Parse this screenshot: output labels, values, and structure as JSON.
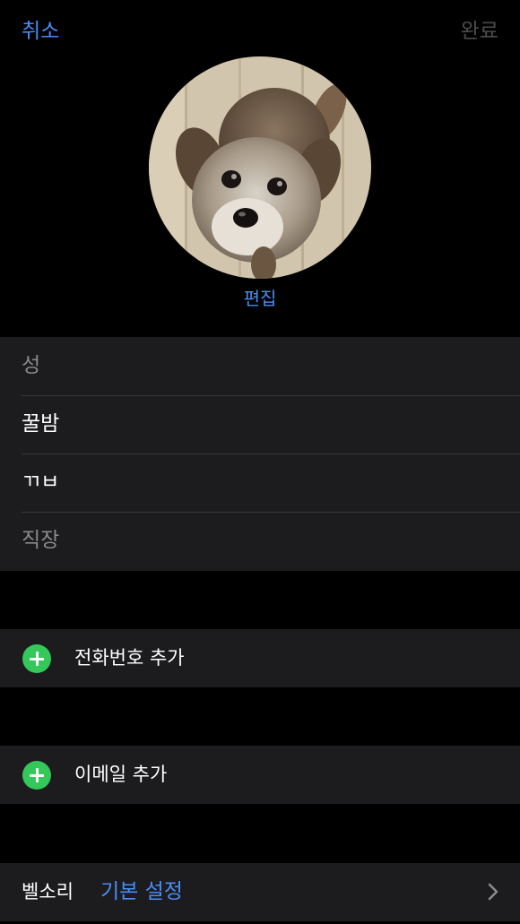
{
  "nav": {
    "cancel_label": "취소",
    "done_label": "완료"
  },
  "photo": {
    "subject": "dog photo",
    "edit_label": "편집"
  },
  "name_fields": [
    {
      "text": "성",
      "state": "placeholder"
    },
    {
      "text": "꿀밤",
      "state": "filled"
    },
    {
      "text": "ㄲㅂ",
      "state": "filled"
    },
    {
      "text": "직장",
      "state": "placeholder"
    }
  ],
  "add_phone": {
    "label": "전화번호 추가",
    "icon": "plus-circle-icon"
  },
  "add_email": {
    "label": "이메일 추가",
    "icon": "plus-circle-icon"
  },
  "ringtone": {
    "label": "벨소리",
    "value": "기본 설정",
    "icon": "chevron-right-icon"
  },
  "colors": {
    "accent": "#4a8cf7",
    "add_green": "#34c759",
    "cell_background": "#1c1c1e",
    "done_disabled": "#4c4c4f"
  }
}
